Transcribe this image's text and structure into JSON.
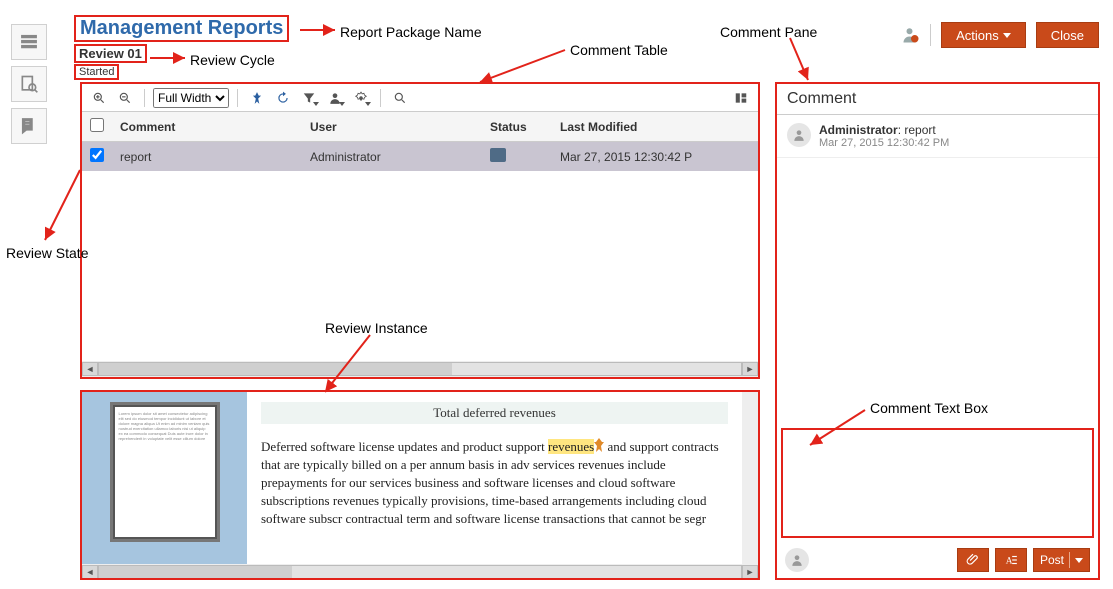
{
  "header": {
    "package_name": "Management Reports",
    "review_cycle": "Review 01",
    "review_state": "Started",
    "actions_label": "Actions",
    "close_label": "Close"
  },
  "annotations": {
    "package_name": "Report Package Name",
    "review_cycle": "Review Cycle",
    "review_state": "Review State",
    "comment_table": "Comment Table",
    "comment_pane": "Comment Pane",
    "review_instance": "Review Instance",
    "comment_text_box": "Comment Text Box"
  },
  "toolbar": {
    "zoom_value": "Full Width",
    "zoom_options": [
      "Full Width"
    ]
  },
  "table": {
    "headers": {
      "comment": "Comment",
      "user": "User",
      "status": "Status",
      "last_modified": "Last Modified"
    },
    "rows": [
      {
        "checked": true,
        "comment": "report",
        "user": "Administrator",
        "last_modified": "Mar 27, 2015 12:30:42 P"
      }
    ]
  },
  "instance": {
    "doc_title": "Total deferred revenues",
    "highlight_word": "revenues",
    "doc_text_pre": "Deferred software license updates and product support ",
    "doc_text_post": " and support contracts that are typically billed on a per annum basis in adv services revenues include prepayments for our services business and software licenses and cloud software subscriptions revenues typically provisions, time-based arrangements including cloud software subscr contractual term and software license transactions that cannot be segr"
  },
  "comment_pane": {
    "title": "Comment",
    "entry": {
      "user": "Administrator",
      "text": "report",
      "timestamp": "Mar 27, 2015 12:30:42 PM"
    },
    "post_label": "Post",
    "input_placeholder": ""
  }
}
